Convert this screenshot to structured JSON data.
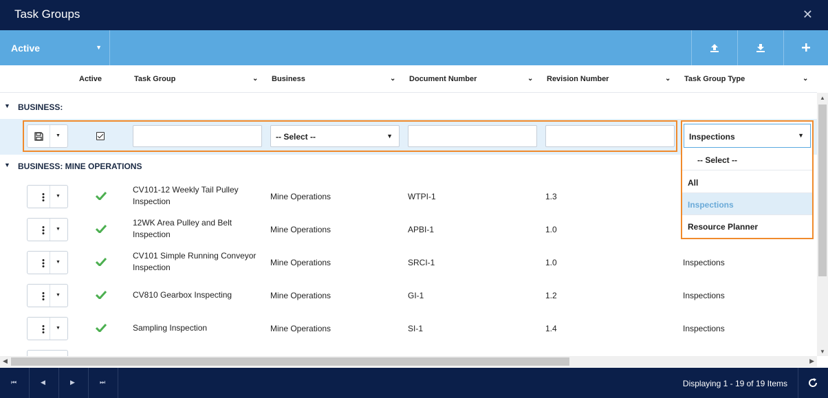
{
  "window": {
    "title": "Task Groups"
  },
  "toolbar": {
    "filter_label": "Active"
  },
  "columns": {
    "active": "Active",
    "task_group": "Task Group",
    "business": "Business",
    "document_number": "Document Number",
    "revision_number": "Revision Number",
    "task_group_type": "Task Group Type"
  },
  "groups": [
    {
      "label": "BUSINESS:"
    },
    {
      "label": "BUSINESS: MINE OPERATIONS"
    }
  ],
  "edit_row": {
    "business_select": "-- Select --",
    "type_select": "Inspections"
  },
  "dropdown": {
    "options": [
      "-- Select --",
      "All",
      "Inspections",
      "Resource Planner"
    ],
    "highlighted": "Inspections"
  },
  "rows": [
    {
      "task_group": "CV101-12 Weekly Tail Pulley Inspection",
      "business": "Mine Operations",
      "document_number": "WTPI-1",
      "revision_number": "1.3",
      "type": ""
    },
    {
      "task_group": "12WK Area Pulley and Belt Inspection",
      "business": "Mine Operations",
      "document_number": "APBI-1",
      "revision_number": "1.0",
      "type": ""
    },
    {
      "task_group": "CV101 Simple Running Conveyor Inspection",
      "business": "Mine Operations",
      "document_number": "SRCI-1",
      "revision_number": "1.0",
      "type": "Inspections"
    },
    {
      "task_group": "CV810 Gearbox Inspecting",
      "business": "Mine Operations",
      "document_number": "GI-1",
      "revision_number": "1.2",
      "type": "Inspections"
    },
    {
      "task_group": "Sampling Inspection",
      "business": "Mine Operations",
      "document_number": "SI-1",
      "revision_number": "1.4",
      "type": "Inspections"
    }
  ],
  "pager": {
    "info": "Displaying 1 - 19 of 19 Items"
  },
  "colors": {
    "navy": "#0b1f4a",
    "toolbar_blue": "#5aa9e0",
    "highlight_orange": "#f08a2b",
    "check_green": "#4caf50"
  }
}
